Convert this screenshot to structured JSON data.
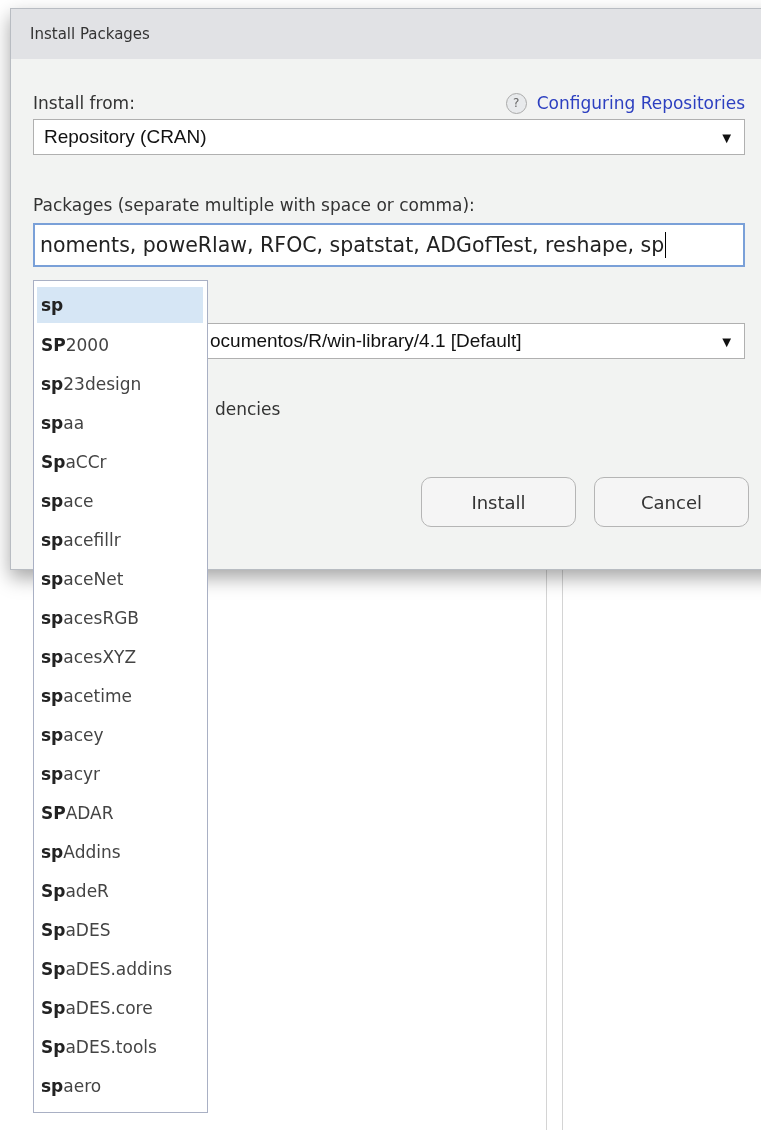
{
  "dialog": {
    "title": "Install Packages",
    "install_from": {
      "label": "Install from:",
      "help_mark": "?",
      "help_link": "Configuring Repositories",
      "value": "Repository (CRAN)",
      "arrow": "▼"
    },
    "packages": {
      "label": "Packages (separate multiple with space or comma):",
      "value": "noments, poweRlaw, RFOC, spatstat, ADGofTest, reshape, sp"
    },
    "library": {
      "value": "ocumentos/R/win-library/4.1 [Default]",
      "arrow": "▼"
    },
    "dependencies": {
      "label": "dencies"
    },
    "buttons": [
      "Install",
      "Cancel"
    ]
  },
  "autocomplete": [
    {
      "label": "**sp**",
      "selected": true
    },
    {
      "label": "**SP**2000",
      "selected": false
    },
    {
      "label": "**sp**23design",
      "selected": false
    },
    {
      "label": "**sp**aa",
      "selected": false
    },
    {
      "label": "**Sp**aCCr",
      "selected": false
    },
    {
      "label": "**sp**ace",
      "selected": false
    },
    {
      "label": "**sp**acefillr",
      "selected": false
    },
    {
      "label": "**sp**aceNet",
      "selected": false
    },
    {
      "label": "**sp**acesRGB",
      "selected": false
    },
    {
      "label": "**sp**acesXYZ",
      "selected": false
    },
    {
      "label": "**sp**acetime",
      "selected": false
    },
    {
      "label": "**sp**acey",
      "selected": false
    },
    {
      "label": "**sp**acyr",
      "selected": false
    },
    {
      "label": "**SP**ADAR",
      "selected": false
    },
    {
      "label": "**sp**Addins",
      "selected": false
    },
    {
      "label": "**Sp**adeR",
      "selected": false
    },
    {
      "label": "**Sp**aDES",
      "selected": false
    },
    {
      "label": "**Sp**aDES.addins",
      "selected": false
    },
    {
      "label": "**Sp**aDES.core",
      "selected": false
    },
    {
      "label": "**Sp**aDES.tools",
      "selected": false
    },
    {
      "label": "**sp**aero",
      "selected": false
    }
  ]
}
